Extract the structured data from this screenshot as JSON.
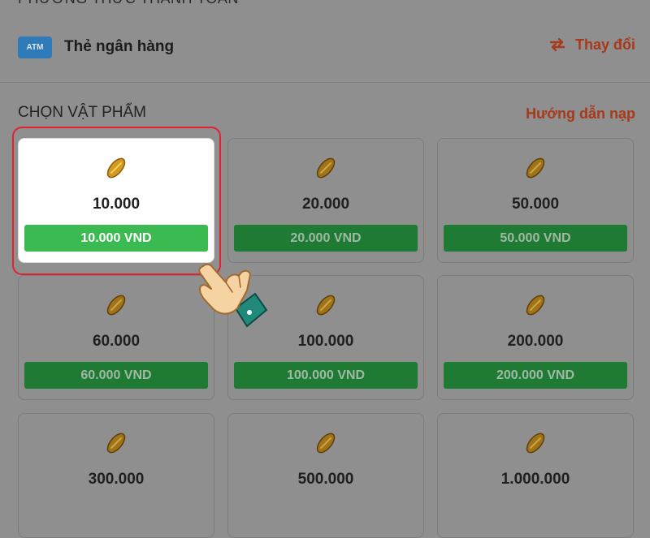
{
  "header": {
    "section_title": "PHƯƠNG THỨC THANH TOÁN"
  },
  "payment": {
    "badge": "ATM",
    "name": "Thẻ ngân hàng",
    "change_label": "Thay đổi",
    "accent_color": "#a8391a"
  },
  "items_section": {
    "title": "CHỌN VẬT PHẨM",
    "guide_link": "Hướng dẫn nạp"
  },
  "items": [
    {
      "amount": "10.000",
      "price": "10.000 VND",
      "selected": true
    },
    {
      "amount": "20.000",
      "price": "20.000 VND",
      "selected": false
    },
    {
      "amount": "50.000",
      "price": "50.000 VND",
      "selected": false
    },
    {
      "amount": "60.000",
      "price": "60.000 VND",
      "selected": false
    },
    {
      "amount": "100.000",
      "price": "100.000 VND",
      "selected": false
    },
    {
      "amount": "200.000",
      "price": "200.000 VND",
      "selected": false
    },
    {
      "amount": "300.000",
      "price": "",
      "selected": false
    },
    {
      "amount": "500.000",
      "price": "",
      "selected": false
    },
    {
      "amount": "1.000.000",
      "price": "",
      "selected": false
    }
  ],
  "icons": {
    "coin": "coin-icon",
    "swap": "swap-arrows-icon",
    "pointer": "pointing-hand-icon"
  },
  "colors": {
    "selected_button": "#3cba52",
    "button": "#1f7a33",
    "highlight_border": "#e0232f"
  }
}
